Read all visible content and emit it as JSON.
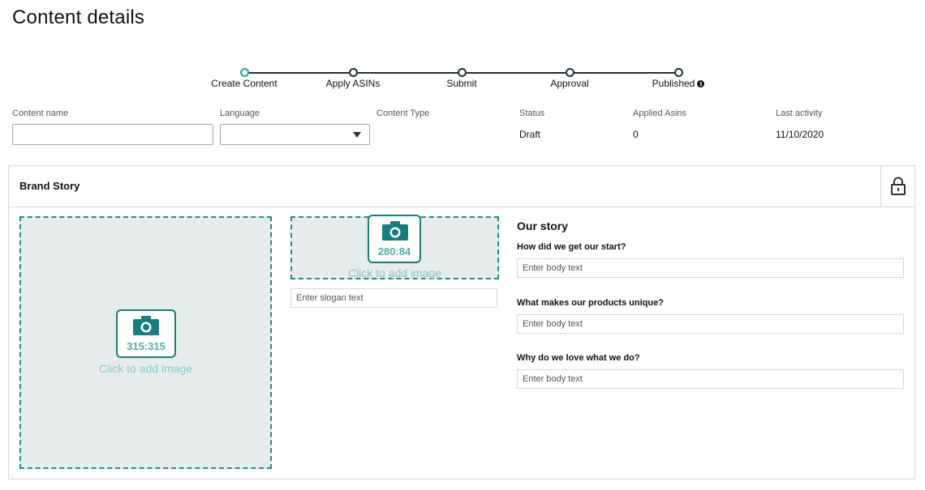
{
  "page": {
    "title": "Content details"
  },
  "tracker": {
    "steps": [
      {
        "label": "Create Content",
        "active": true
      },
      {
        "label": "Apply ASINs",
        "active": false
      },
      {
        "label": "Submit",
        "active": false
      },
      {
        "label": "Approval",
        "active": false
      },
      {
        "label": "Published",
        "active": false,
        "info_icon": "info-icon"
      }
    ]
  },
  "meta": {
    "content_name": {
      "label": "Content name",
      "value": ""
    },
    "language": {
      "label": "Language",
      "value": ""
    },
    "content_type": {
      "label": "Content Type",
      "value": ""
    },
    "status": {
      "label": "Status",
      "value": "Draft"
    },
    "applied_asins": {
      "label": "Applied Asins",
      "value": "0"
    },
    "last_activity": {
      "label": "Last activity",
      "value": "11/10/2020"
    }
  },
  "brand_story": {
    "title": "Brand Story",
    "lock_icon": "lock-icon",
    "main_image": {
      "ratio": "315:315",
      "cta": "Click to add image",
      "icon": "camera-icon"
    },
    "logo_image": {
      "ratio": "280:84",
      "cta": "Click to add image",
      "icon": "camera-icon"
    },
    "slogan_placeholder": "Enter slogan text",
    "story": {
      "title": "Our story",
      "questions": [
        {
          "label": "How did we get our start?",
          "placeholder": "Enter body text"
        },
        {
          "label": "What makes our products unique?",
          "placeholder": "Enter body text"
        },
        {
          "label": "Why do we love what we do?",
          "placeholder": "Enter body text"
        }
      ]
    }
  },
  "colors": {
    "accent_teal": "#21a0a0",
    "tracker_line": "#232f3e",
    "drop_bg": "#e6eceb"
  }
}
